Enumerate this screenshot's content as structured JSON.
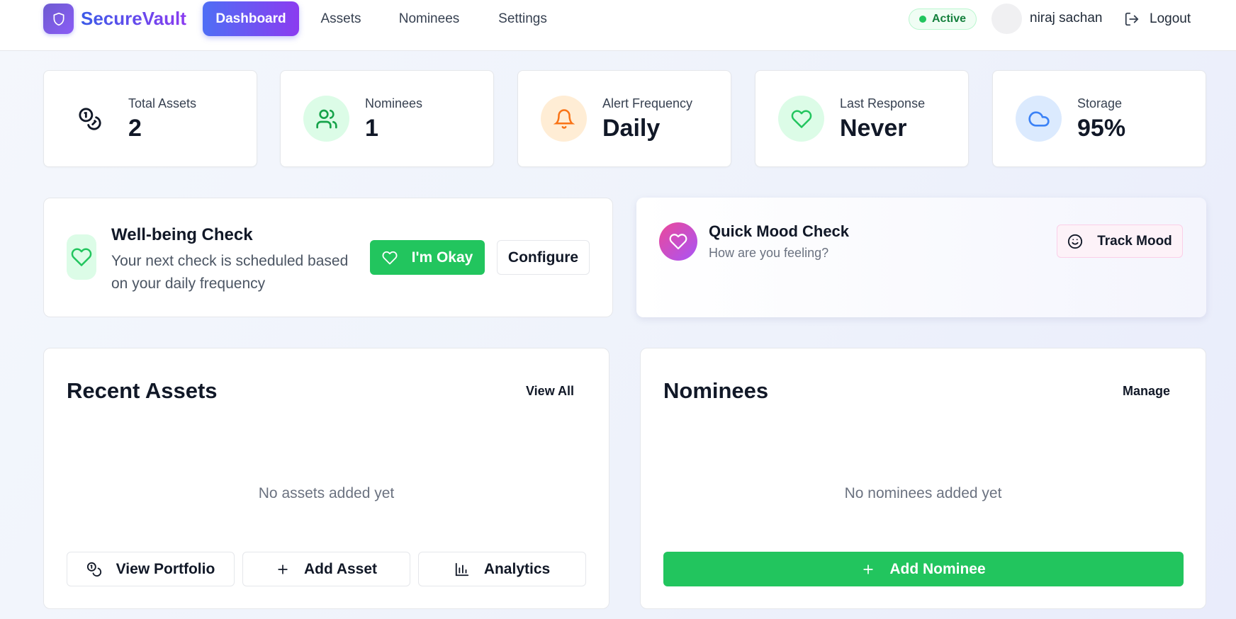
{
  "app": {
    "brand": "SecureVault",
    "logo_icon": "shield-icon"
  },
  "nav": {
    "items": [
      {
        "label": "Dashboard",
        "active": true
      },
      {
        "label": "Assets",
        "active": false
      },
      {
        "label": "Nominees",
        "active": false
      },
      {
        "label": "Settings",
        "active": false
      }
    ],
    "status": "Active",
    "user_name": "niraj sachan",
    "logout_label": "Logout"
  },
  "stats": [
    {
      "label": "Total Assets",
      "value": "2",
      "icon": "coins-icon",
      "bg": "#ffffff",
      "color": "#111827"
    },
    {
      "label": "Nominees",
      "value": "1",
      "icon": "users-icon",
      "bg": "#dcfce7",
      "color": "#16a34a"
    },
    {
      "label": "Alert Frequency",
      "value": "Daily",
      "icon": "bell-icon",
      "bg": "#ffedd5",
      "color": "#f97316"
    },
    {
      "label": "Last Response",
      "value": "Never",
      "icon": "heart-icon",
      "bg": "#dcfce7",
      "color": "#22c55e"
    },
    {
      "label": "Storage",
      "value": "95%",
      "icon": "cloud-icon",
      "bg": "#dbeafe",
      "color": "#3b82f6"
    }
  ],
  "wellbeing": {
    "title": "Well-being Check",
    "description": "Your next check is scheduled based on your daily frequency",
    "okay_label": "I'm Okay",
    "configure_label": "Configure"
  },
  "mood": {
    "title": "Quick Mood Check",
    "subtitle": "How are you feeling?",
    "track_label": "Track Mood"
  },
  "recent_assets": {
    "title": "Recent Assets",
    "view_all_label": "View All",
    "empty_text": "No assets added yet",
    "actions": [
      {
        "label": "View Portfolio",
        "icon": "coins-icon"
      },
      {
        "label": "Add Asset",
        "icon": "plus-icon"
      },
      {
        "label": "Analytics",
        "icon": "bar-chart-icon"
      }
    ]
  },
  "nominees_panel": {
    "title": "Nominees",
    "manage_label": "Manage",
    "empty_text": "No nominees added yet",
    "add_label": "Add Nominee"
  },
  "colors": {
    "accent_gradient_start": "#4f6ef5",
    "accent_gradient_end": "#8b3cf0",
    "success": "#22c55e"
  }
}
